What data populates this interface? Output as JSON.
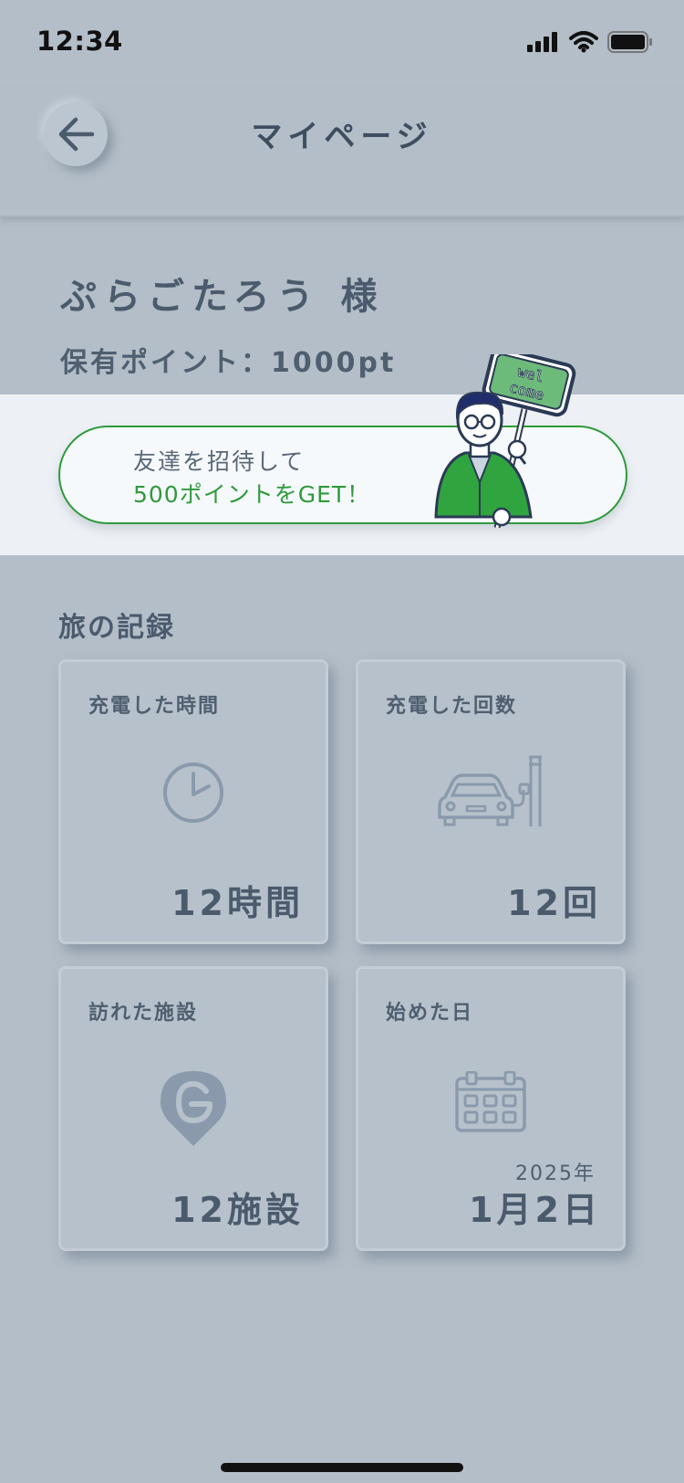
{
  "status": {
    "time": "12:34"
  },
  "nav": {
    "title": "マイページ"
  },
  "profile": {
    "name": "ぷらごたろう 様",
    "points": "保有ポイント：1000pt"
  },
  "invite": {
    "line1": "友達を招待して",
    "line2": "500ポイントをGET！",
    "sign_text_1": "wel",
    "sign_text_2": "come"
  },
  "records": {
    "title": "旅の記録",
    "cards": [
      {
        "label": "充電した時間",
        "value": "12時間",
        "icon": "clock-icon"
      },
      {
        "label": "充電した回数",
        "value": "12回",
        "icon": "car-charger-icon"
      },
      {
        "label": "訪れた施設",
        "value": "12施設",
        "icon": "map-pin-icon"
      },
      {
        "label": "始めた日",
        "year": "2025年",
        "value": "1月2日",
        "icon": "calendar-icon"
      }
    ]
  },
  "colors": {
    "background": "#b4bec8",
    "accent_green": "#2f9a3b",
    "text": "#4b5b6d",
    "icon": "#8a9aac"
  }
}
